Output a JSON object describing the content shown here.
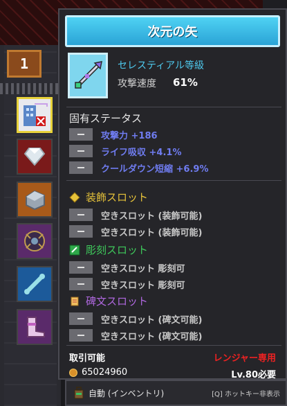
{
  "inventory": {
    "counter": "1"
  },
  "tooltip": {
    "item_name": "次元の矢",
    "item_type": "セレスティアル等級",
    "attack_speed_label": "攻撃速度",
    "attack_speed_value": "61%",
    "fixed_status_header": "固有ステータス",
    "fixed_stats": [
      {
        "text": "攻撃力 +186"
      },
      {
        "text": "ライフ吸収 +4.1%"
      },
      {
        "text": "クールダウン短縮 +6.9%"
      }
    ],
    "accessory_header": "装飾スロット",
    "accessory_slots": [
      {
        "text": "空きスロット (装飾可能)"
      },
      {
        "text": "空きスロット (装飾可能)"
      }
    ],
    "engrave_header": "彫刻スロット",
    "engrave_slots": [
      {
        "text": "空きスロット 彫刻可"
      },
      {
        "text": "空きスロット 彫刻可"
      }
    ],
    "rune_header": "碑文スロット",
    "rune_slots": [
      {
        "text": "空きスロット (碑文可能)"
      },
      {
        "text": "空きスロット (碑文可能)"
      }
    ],
    "tradable": "取引可能",
    "class_requirement": "レンジャー専用",
    "price": "65024960",
    "level_requirement": "Lv.80必要"
  },
  "bottom_bar": {
    "auto_label": "自動 (インベントリ)",
    "hotkey_label": "[Q] ホットキー非表示"
  },
  "colors": {
    "title_bar": "#2aa3d6",
    "item_type": "#4ec8ec",
    "fixed_stat": "#6f7cf0",
    "accessory": "#e7c33a",
    "engrave": "#3ec95b",
    "rune": "#b068e0",
    "class_req": "#ee2222"
  }
}
